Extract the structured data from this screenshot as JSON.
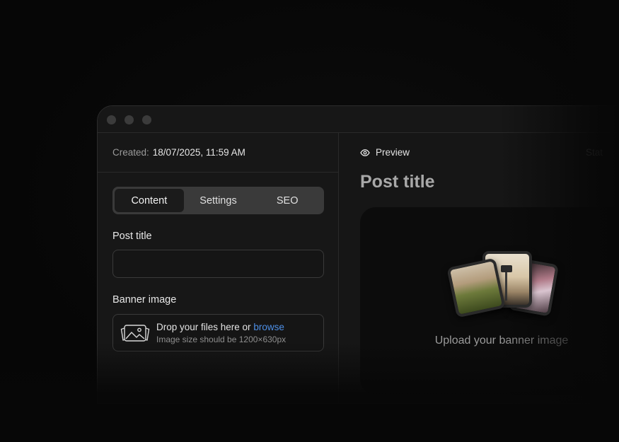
{
  "window": {
    "created_label": "Created:",
    "created_value": "18/07/2025, 11:59 AM"
  },
  "tabs": [
    {
      "label": "Content",
      "active": true
    },
    {
      "label": "Settings",
      "active": false
    },
    {
      "label": "SEO",
      "active": false
    }
  ],
  "form": {
    "post_title_label": "Post title",
    "post_title_value": "",
    "banner_label": "Banner image",
    "dropzone_text": "Drop your files here or ",
    "dropzone_link": "browse",
    "dropzone_hint": "Image size should be 1200×630px"
  },
  "preview": {
    "label": "Preview",
    "status_partial": "Stat",
    "post_title": "Post title",
    "upload_text": "Upload your banner image"
  },
  "colors": {
    "accent_link": "#4d8fe6",
    "background": "#070707",
    "panel": "#161616"
  },
  "icons": {
    "preview": "eye-icon",
    "dropzone": "image-gallery-icon"
  }
}
